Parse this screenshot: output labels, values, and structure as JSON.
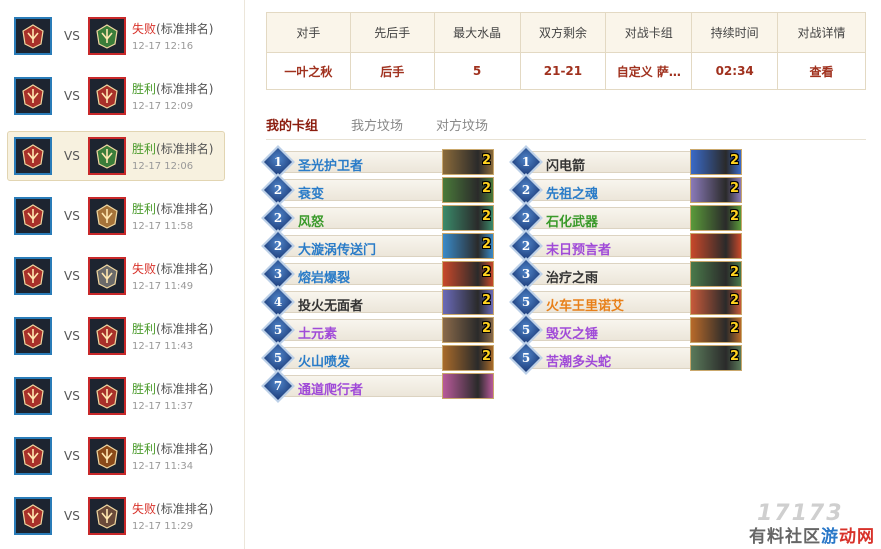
{
  "sidebar": {
    "matches": [
      {
        "result": "失败",
        "mode": "(标准排名)",
        "time": "12-17 12:16",
        "win": false,
        "opp_icon": "sword-hilt-icon",
        "opp_color": "#3a7d3a"
      },
      {
        "result": "胜利",
        "mode": "(标准排名)",
        "time": "12-17 12:09",
        "win": true,
        "opp_icon": "shaman-emblem-icon",
        "opp_color": "#a8312a"
      },
      {
        "result": "胜利",
        "mode": "(标准排名)",
        "time": "12-17 12:06",
        "win": true,
        "opp_icon": "sword-hilt-icon",
        "opp_color": "#3a7d3a"
      },
      {
        "result": "胜利",
        "mode": "(标准排名)",
        "time": "12-17 11:58",
        "win": true,
        "opp_icon": "shield-icon",
        "opp_color": "#a5733a"
      },
      {
        "result": "失败",
        "mode": "(标准排名)",
        "time": "12-17 11:49",
        "win": false,
        "opp_icon": "sword-icon",
        "opp_color": "#6a6a6a"
      },
      {
        "result": "胜利",
        "mode": "(标准排名)",
        "time": "12-17 11:43",
        "win": true,
        "opp_icon": "shaman-emblem-icon",
        "opp_color": "#a8312a"
      },
      {
        "result": "胜利",
        "mode": "(标准排名)",
        "time": "12-17 11:37",
        "win": true,
        "opp_icon": "shaman-emblem-icon",
        "opp_color": "#a8312a"
      },
      {
        "result": "胜利",
        "mode": "(标准排名)",
        "time": "12-17 11:34",
        "win": true,
        "opp_icon": "bow-icon",
        "opp_color": "#8a4a1a"
      },
      {
        "result": "失败",
        "mode": "(标准排名)",
        "time": "12-17 11:29",
        "win": false,
        "opp_icon": "claw-icon",
        "opp_color": "#6a4a3a"
      }
    ],
    "vs_label": "VS"
  },
  "info": {
    "headers": [
      "对手",
      "先后手",
      "最大水晶",
      "双方剩余",
      "对战卡组",
      "持续时间",
      "对战详情"
    ],
    "values": [
      "一叶之秋",
      "后手",
      "5",
      "21-21",
      "自定义 萨…",
      "02:34",
      "查看"
    ]
  },
  "tabs": [
    "我的卡组",
    "我方坟场",
    "对方坟场"
  ],
  "cards_left": [
    {
      "cost": "1",
      "name": "圣光护卫者",
      "count": "2",
      "color": "#2a7cc8",
      "art": "#8a6a3a"
    },
    {
      "cost": "2",
      "name": "衰变",
      "count": "2",
      "color": "#2a7cc8",
      "art": "#4a7a3a"
    },
    {
      "cost": "2",
      "name": "风怒",
      "count": "2",
      "color": "#3a9a2a",
      "art": "#3a8a6a"
    },
    {
      "cost": "2",
      "name": "大漩涡传送门",
      "count": "2",
      "color": "#2a7cc8",
      "art": "#3a8ac8"
    },
    {
      "cost": "3",
      "name": "熔岩爆裂",
      "count": "2",
      "color": "#2a7cc8",
      "art": "#c8482a"
    },
    {
      "cost": "4",
      "name": "投火无面者",
      "count": "2",
      "color": "#333333",
      "art": "#6a6ab8"
    },
    {
      "cost": "5",
      "name": "土元素",
      "count": "2",
      "color": "#a04ad8",
      "art": "#8a6a4a"
    },
    {
      "cost": "5",
      "name": "火山喷发",
      "count": "2",
      "color": "#2a7cc8",
      "art": "#a86a2a"
    },
    {
      "cost": "7",
      "name": "通道爬行者",
      "count": "",
      "color": "#a04ad8",
      "art": "#b85a9a"
    }
  ],
  "cards_right": [
    {
      "cost": "1",
      "name": "闪电箭",
      "count": "2",
      "color": "#333333",
      "art": "#3a6ac8"
    },
    {
      "cost": "2",
      "name": "先祖之魂",
      "count": "2",
      "color": "#2a7cc8",
      "art": "#8a7ab8"
    },
    {
      "cost": "2",
      "name": "石化武器",
      "count": "2",
      "color": "#3a9a2a",
      "art": "#5a9a3a"
    },
    {
      "cost": "2",
      "name": "末日预言者",
      "count": "",
      "color": "#a04ad8",
      "art": "#c8482a"
    },
    {
      "cost": "3",
      "name": "治疗之雨",
      "count": "2",
      "color": "#333333",
      "art": "#4a7a4a"
    },
    {
      "cost": "5",
      "name": "火车王里诺艾",
      "count": "2",
      "color": "#e8801a",
      "art": "#c85a3a"
    },
    {
      "cost": "5",
      "name": "毁灭之锤",
      "count": "2",
      "color": "#a04ad8",
      "art": "#b86a2a"
    },
    {
      "cost": "5",
      "name": "苦潮多头蛇",
      "count": "2",
      "color": "#a04ad8",
      "art": "#5a7a5a"
    }
  ],
  "watermark": {
    "logo": "17173",
    "text1": "有料社区",
    "text2": "游",
    "text3": "动网"
  }
}
